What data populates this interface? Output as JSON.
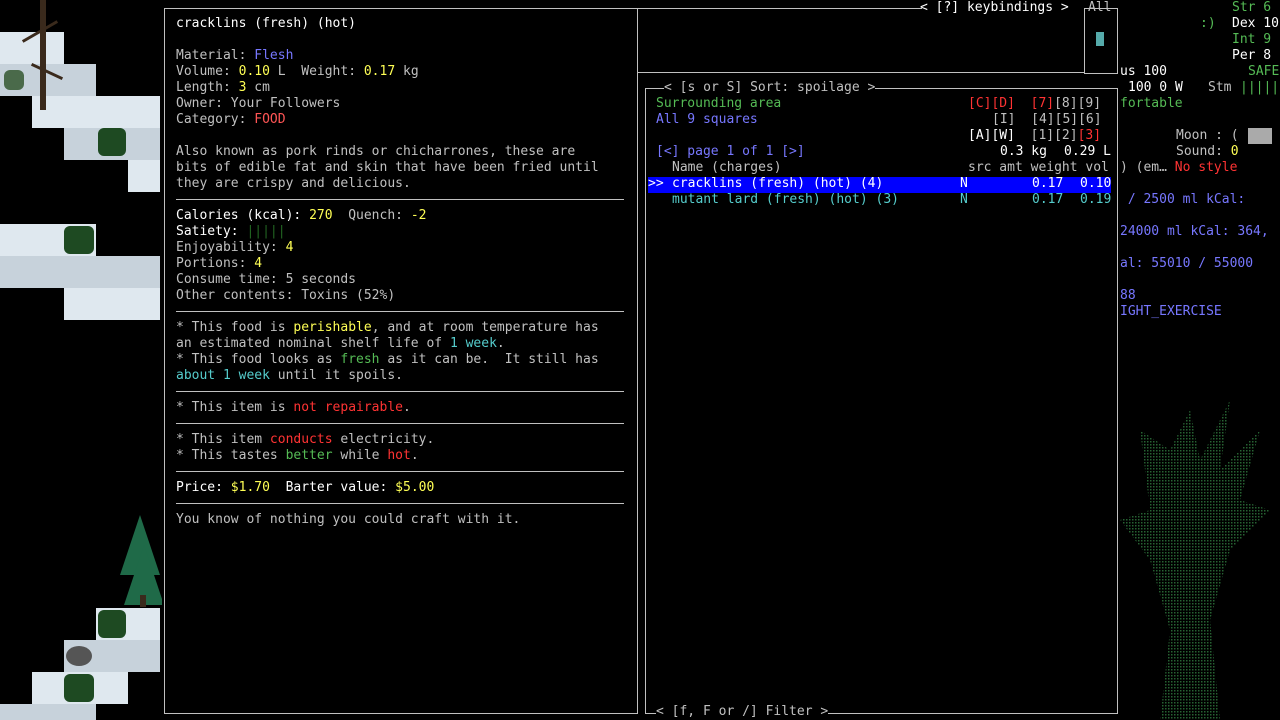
{
  "item_info": {
    "title": "cracklins (fresh) (hot)",
    "material_label": "Material: ",
    "material_value": "Flesh",
    "volume_label": "Volume: ",
    "volume_value": "0.10",
    "volume_unit": " L  Weight: ",
    "weight_value": "0.17",
    "weight_unit": " kg",
    "length_label": "Length: ",
    "length_value": "3",
    "length_unit": " cm",
    "owner": "Owner: Your Followers",
    "category_label": "Category: ",
    "category_value": "FOOD",
    "desc1": "Also known as pork rinds or chicharrones, these are",
    "desc2": "bits of edible fat and skin that have been fried until",
    "desc3": "they are crispy and delicious.",
    "calories_label": "Calories (kcal): ",
    "calories_value": "270",
    "quench_label": "  Quench: ",
    "quench_value": "-2",
    "satiety_label": "Satiety: ",
    "satiety_value": "|||||",
    "enjoy_label": "Enjoyability: ",
    "enjoy_value": "4",
    "portions_label": "Portions: ",
    "portions_value": "4",
    "consume": "Consume time: 5 seconds",
    "other": "Other contents: Toxins (52%)",
    "perish1a": "* This food is ",
    "perish1b": "perishable",
    "perish1c": ", and at room temperature has",
    "perish2a": "an estimated nominal shelf life of ",
    "perish2b": "1 week",
    "perish2c": ".",
    "fresh1a": "* This food looks as ",
    "fresh1b": "fresh",
    "fresh1c": " as it can be.  It still has",
    "fresh2a": "about 1 week",
    "fresh2b": " until it spoils.",
    "repair_a": "* This item is ",
    "repair_b": "not repairable",
    "repair_c": ".",
    "elec_a": "* This item ",
    "elec_b": "conducts",
    "elec_c": " electricity.",
    "taste_a": "* This tastes ",
    "taste_b": "better",
    "taste_c": " while ",
    "taste_d": "hot",
    "taste_e": ".",
    "price_label": "Price: ",
    "price_value": "$1.70",
    "barter_label": "  Barter value: ",
    "barter_value": "$5.00",
    "craft": "You know of nothing you could craft with it."
  },
  "inventory": {
    "keybindings": "< [?] keybindings >",
    "all_tab": "All",
    "sort": "< [s or S] Sort: spoilage >",
    "surrounding": "Surrounding area",
    "all_squares": "All 9 squares",
    "grid_row1_a": "[C][D]",
    "grid_row1_b": "[7]",
    "grid_row1_c": "[8][9]",
    "grid_row2_a": "[I]",
    "grid_row2_b": "[4][5][6]",
    "grid_row3_a": "[A][W]",
    "grid_row3_b": "[1][2]",
    "grid_row3_c": "[3]",
    "page": "[<] page 1 of 1 [>]",
    "total_weight": "0.3 kg",
    "total_vol": "0.29 L",
    "header_name": "Name (charges)",
    "header_cols": "src amt weight vol",
    "rows": [
      {
        "marker": ">>",
        "name": "cracklins (fresh) (hot) (4)",
        "src": "N",
        "weight": "0.17",
        "vol": "0.10"
      },
      {
        "marker": "",
        "name": "mutant lard (fresh) (hot) (3)",
        "src": "N",
        "weight": "0.17",
        "vol": "0.19"
      }
    ],
    "filter": "< [f, F or /] Filter >"
  },
  "sidebar": {
    "str": "Str 6",
    "face": ":)",
    "dex": "Dex 10",
    "int": "Int 9",
    "per": "Per 8",
    "us": "us 100",
    "safe": "SAFE",
    "line_w": "100 0 W",
    "stm": "Stm",
    "stm_bar": "|||||",
    "comfort": "fortable",
    "moon": "Moon : (",
    "sound_label": "Sound: ",
    "sound_value": "0",
    "style_a": ") (em… ",
    "style_b": "No style",
    "kcal1": " / 2500 ml kCal:",
    "kcal2": "24000 ml kCal: 364,",
    "kcal3": "al: 55010 / 55000",
    "num88": "88",
    "exercise": "IGHT_EXERCISE"
  }
}
